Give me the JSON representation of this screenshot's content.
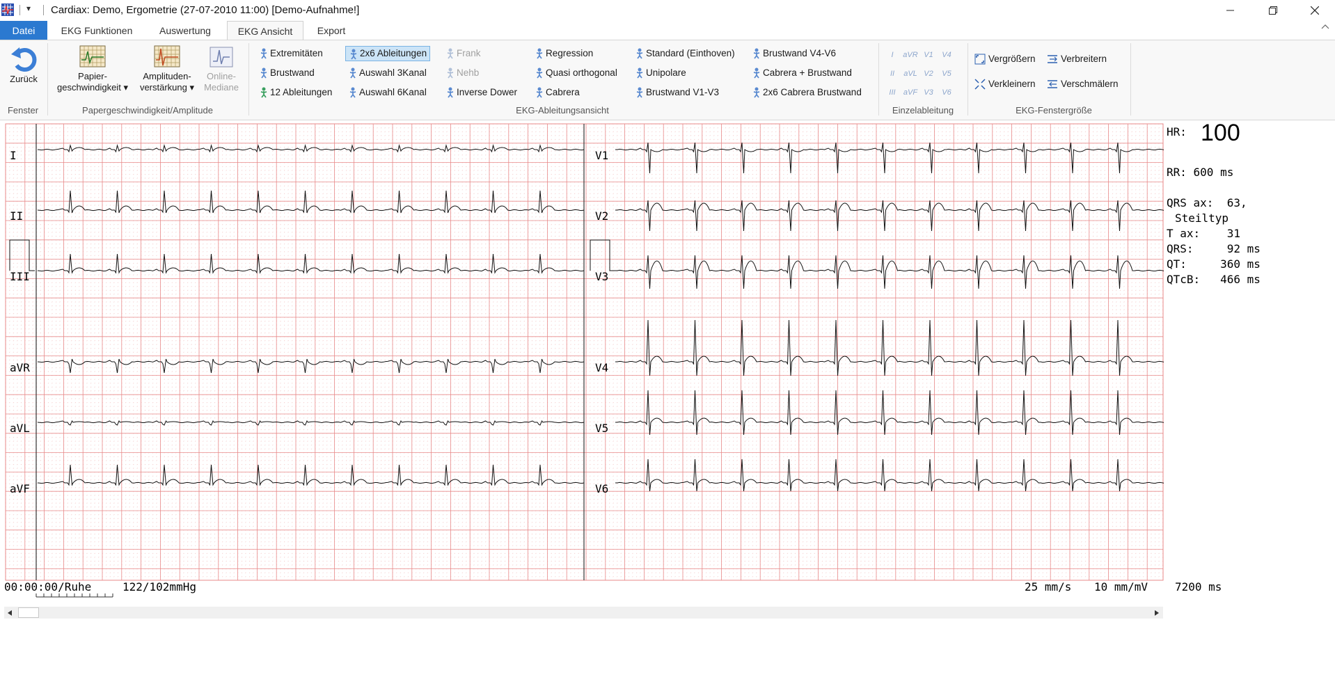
{
  "window": {
    "title": "Cardiax: Demo, Ergometrie (27-07-2010 11:00) [Demo-Aufnahme!]"
  },
  "tabs": [
    "Datei",
    "EKG Funktionen",
    "Auswertung",
    "EKG Ansicht",
    "Export"
  ],
  "active_tab": "EKG Ansicht",
  "ribbon": {
    "fenster": {
      "label": "Fenster",
      "zurueck": "Zurück"
    },
    "paper": {
      "label": "Papergeschwindigkeit/Amplitude",
      "speed_line1": "Papier-",
      "speed_line2": "geschwindigkeit",
      "amp_line1": "Amplituden-",
      "amp_line2": "verstärkung",
      "median_line1": "Online-",
      "median_line2": "Mediane"
    },
    "view": {
      "label": "EKG-Ableitungsansicht",
      "col1": [
        "Extremitäten",
        "Brustwand",
        "12 Ableitungen"
      ],
      "col2": [
        "2x6 Ableitungen",
        "Auswahl 3Kanal",
        "Auswahl 6Kanal"
      ],
      "col3": [
        "Frank",
        "Nehb",
        "Inverse Dower"
      ],
      "col4": [
        "Regression",
        "Quasi orthogonal",
        "Cabrera"
      ],
      "col5": [
        "Standard (Einthoven)",
        "Unipolare",
        "Brustwand V1-V3"
      ],
      "col6": [
        "Brustwand V4-V6",
        "Cabrera + Brustwand",
        "2x6 Cabrera  Brustwand"
      ],
      "selected": "2x6 Ableitungen",
      "disabled": [
        "Frank",
        "Nehb",
        "Online-Mediane"
      ]
    },
    "single": {
      "label": "Einzelableitung",
      "rows": [
        [
          "I",
          "aVR",
          "V1",
          "V4"
        ],
        [
          "II",
          "aVL",
          "V2",
          "V5"
        ],
        [
          "III",
          "aVF",
          "V3",
          "V6"
        ]
      ]
    },
    "size": {
      "label": "EKG-Fenstergröße",
      "enlarge": "Vergrößern",
      "widen": "Verbreitern",
      "shrink": "Verkleinern",
      "narrow": "Verschmälern"
    }
  },
  "ecg": {
    "leads_left": [
      "I",
      "II",
      "III",
      "aVR",
      "aVL",
      "aVF"
    ],
    "leads_right": [
      "V1",
      "V2",
      "V3",
      "V4",
      "V5",
      "V6"
    ],
    "grid_minor_color": "#f4c6c6",
    "grid_major_color": "#e88a8a"
  },
  "measurements": {
    "hr_label": "HR:",
    "hr_value": "100",
    "rr": "RR: 600 ms",
    "qrs_ax": "QRS ax:  63,",
    "type": "Steiltyp",
    "t_ax": "T ax:    31",
    "qrs": "QRS:     92 ms",
    "qt": "QT:     360 ms",
    "qtcb": "QTcB:   466 ms"
  },
  "status": {
    "time": "00:00:00/Ruhe",
    "bp": "122/102mmHg",
    "speed": "25 mm/s",
    "gain": "10 mm/mV",
    "duration": "7200 ms"
  }
}
